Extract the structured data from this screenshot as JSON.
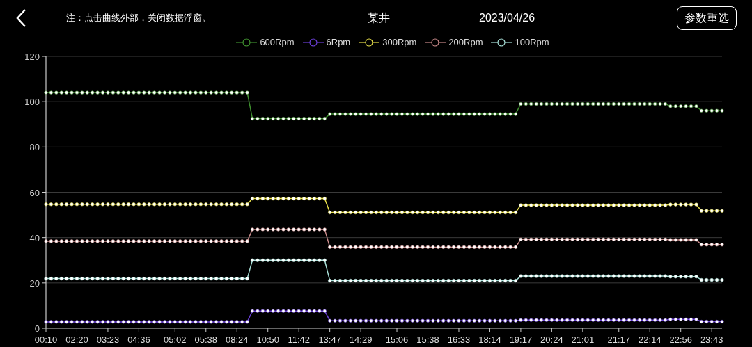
{
  "header": {
    "note": "注：点击曲线外部，关闭数据浮窗。",
    "title": "某井",
    "date": "2023/04/26",
    "button": "参数重选"
  },
  "chart": {
    "chart_data": {
      "type": "line",
      "categories": [
        "00:10",
        null,
        null,
        null,
        null,
        null,
        "02:20",
        null,
        null,
        null,
        null,
        null,
        "03:23",
        null,
        null,
        null,
        null,
        null,
        "04:36",
        null,
        null,
        null,
        null,
        null,
        null,
        "05:02",
        null,
        null,
        null,
        null,
        null,
        "05:38",
        null,
        null,
        null,
        null,
        null,
        "08:24",
        null,
        null,
        null,
        null,
        null,
        "10:50",
        null,
        null,
        null,
        null,
        null,
        "11:42",
        null,
        null,
        null,
        null,
        null,
        "13:47",
        null,
        null,
        null,
        null,
        null,
        "14:29",
        null,
        null,
        null,
        null,
        null,
        null,
        "15:06",
        null,
        null,
        null,
        null,
        null,
        "15:38",
        null,
        null,
        null,
        null,
        null,
        "16:33",
        null,
        null,
        null,
        null,
        null,
        "18:14",
        null,
        null,
        null,
        null,
        null,
        "19:17",
        null,
        null,
        null,
        null,
        null,
        "20:24",
        null,
        null,
        null,
        null,
        null,
        "21:01",
        null,
        null,
        null,
        null,
        null,
        null,
        "21:17",
        null,
        null,
        null,
        null,
        null,
        "22:14",
        null,
        null,
        null,
        null,
        null,
        "22:56",
        null,
        null,
        null,
        null,
        null,
        "23:43",
        null,
        null
      ],
      "ylim": [
        0,
        120
      ],
      "grid": true,
      "legend": "top",
      "yticks": [
        0,
        20,
        40,
        60,
        80,
        100,
        120
      ],
      "series": [
        {
          "name": "600Rpm",
          "color": "#3f8f2f",
          "marker": "circle",
          "values": [
            104,
            104,
            104,
            104,
            104,
            104,
            104,
            104,
            104,
            104,
            104,
            104,
            104,
            104,
            104,
            104,
            104,
            104,
            104,
            104,
            104,
            104,
            104,
            104,
            104,
            104,
            104,
            104,
            104,
            104,
            104,
            104,
            104,
            104,
            104,
            104,
            104,
            104,
            104,
            104,
            92.5,
            92.5,
            92.5,
            92.5,
            92.5,
            92.5,
            92.5,
            92.5,
            92.5,
            92.5,
            92.5,
            92.5,
            92.5,
            92.5,
            92.5,
            94.5,
            94.5,
            94.5,
            94.5,
            94.5,
            94.5,
            94.5,
            94.5,
            94.5,
            94.5,
            94.5,
            94.5,
            94.5,
            94.5,
            94.5,
            94.5,
            94.5,
            94.5,
            94.5,
            94.5,
            94.5,
            94.5,
            94.5,
            94.5,
            94.5,
            94.5,
            94.5,
            94.5,
            94.5,
            94.5,
            94.5,
            94.5,
            94.5,
            94.5,
            94.5,
            94.5,
            94.5,
            99,
            99,
            99,
            99,
            99,
            99,
            99,
            99,
            99,
            99,
            99,
            99,
            99,
            99,
            99,
            99,
            99,
            99,
            99,
            99,
            99,
            99,
            99,
            99,
            99,
            99,
            99,
            99,
            99,
            98,
            98,
            98,
            98,
            98,
            98,
            96,
            96,
            96,
            96,
            96
          ]
        },
        {
          "name": "6Rpm",
          "color": "#6a3fd6",
          "marker": "circle",
          "values": [
            2.8,
            2.8,
            2.8,
            2.8,
            2.8,
            2.8,
            2.8,
            2.8,
            2.8,
            2.8,
            2.8,
            2.8,
            2.8,
            2.8,
            2.8,
            2.8,
            2.8,
            2.8,
            2.8,
            2.8,
            2.8,
            2.8,
            2.8,
            2.8,
            2.8,
            2.8,
            2.8,
            2.8,
            2.8,
            2.8,
            2.8,
            2.8,
            2.8,
            2.8,
            2.8,
            2.8,
            2.8,
            2.8,
            2.8,
            2.8,
            7.6,
            7.6,
            7.6,
            7.6,
            7.6,
            7.6,
            7.6,
            7.6,
            7.6,
            7.6,
            7.6,
            7.6,
            7.6,
            7.6,
            7.6,
            3.3,
            3.3,
            3.3,
            3.3,
            3.3,
            3.3,
            3.3,
            3.3,
            3.3,
            3.3,
            3.3,
            3.3,
            3.3,
            3.3,
            3.3,
            3.3,
            3.3,
            3.3,
            3.3,
            3.3,
            3.3,
            3.3,
            3.3,
            3.3,
            3.3,
            3.3,
            3.3,
            3.3,
            3.3,
            3.3,
            3.3,
            3.3,
            3.3,
            3.3,
            3.3,
            3.3,
            3.3,
            3.6,
            3.6,
            3.6,
            3.6,
            3.6,
            3.6,
            3.6,
            3.6,
            3.6,
            3.6,
            3.6,
            3.6,
            3.6,
            3.6,
            3.6,
            3.6,
            3.6,
            3.6,
            3.6,
            3.6,
            3.6,
            3.6,
            3.6,
            3.6,
            3.6,
            3.6,
            3.6,
            3.6,
            3.6,
            3.9,
            3.9,
            3.9,
            3.9,
            3.9,
            3.9,
            2.9,
            2.9,
            2.9,
            2.9,
            2.9
          ]
        },
        {
          "name": "300Rpm",
          "color": "#e8e04a",
          "marker": "circle",
          "values": [
            54.7,
            54.7,
            54.7,
            54.7,
            54.7,
            54.7,
            54.7,
            54.7,
            54.7,
            54.7,
            54.7,
            54.7,
            54.7,
            54.7,
            54.7,
            54.7,
            54.7,
            54.7,
            54.7,
            54.7,
            54.7,
            54.7,
            54.7,
            54.7,
            54.7,
            54.7,
            54.7,
            54.7,
            54.7,
            54.7,
            54.7,
            54.7,
            54.7,
            54.7,
            54.7,
            54.7,
            54.7,
            54.7,
            54.7,
            54.7,
            57.2,
            57.2,
            57.2,
            57.2,
            57.2,
            57.2,
            57.2,
            57.2,
            57.2,
            57.2,
            57.2,
            57.2,
            57.2,
            57.2,
            57.2,
            51.1,
            51.1,
            51.1,
            51.1,
            51.1,
            51.1,
            51.1,
            51.1,
            51.1,
            51.1,
            51.1,
            51.1,
            51.1,
            51.1,
            51.1,
            51.1,
            51.1,
            51.1,
            51.1,
            51.1,
            51.1,
            51.1,
            51.1,
            51.1,
            51.1,
            51.1,
            51.1,
            51.1,
            51.1,
            51.1,
            51.1,
            51.1,
            51.1,
            51.1,
            51.1,
            51.1,
            51.1,
            54.3,
            54.3,
            54.3,
            54.3,
            54.3,
            54.3,
            54.3,
            54.3,
            54.3,
            54.3,
            54.3,
            54.3,
            54.3,
            54.3,
            54.3,
            54.3,
            54.3,
            54.3,
            54.3,
            54.3,
            54.3,
            54.3,
            54.3,
            54.3,
            54.3,
            54.3,
            54.3,
            54.3,
            54.3,
            54.6,
            54.6,
            54.6,
            54.6,
            54.6,
            54.6,
            51.8,
            51.8,
            51.8,
            51.8,
            51.8
          ]
        },
        {
          "name": "200Rpm",
          "color": "#c98a8a",
          "marker": "circle",
          "values": [
            38.4,
            38.4,
            38.4,
            38.4,
            38.4,
            38.4,
            38.4,
            38.4,
            38.4,
            38.4,
            38.4,
            38.4,
            38.4,
            38.4,
            38.4,
            38.4,
            38.4,
            38.4,
            38.4,
            38.4,
            38.4,
            38.4,
            38.4,
            38.4,
            38.4,
            38.4,
            38.4,
            38.4,
            38.4,
            38.4,
            38.4,
            38.4,
            38.4,
            38.4,
            38.4,
            38.4,
            38.4,
            38.4,
            38.4,
            38.4,
            43.6,
            43.6,
            43.6,
            43.6,
            43.6,
            43.6,
            43.6,
            43.6,
            43.6,
            43.6,
            43.6,
            43.6,
            43.6,
            43.6,
            43.6,
            35.8,
            35.8,
            35.8,
            35.8,
            35.8,
            35.8,
            35.8,
            35.8,
            35.8,
            35.8,
            35.8,
            35.8,
            35.8,
            35.8,
            35.8,
            35.8,
            35.8,
            35.8,
            35.8,
            35.8,
            35.8,
            35.8,
            35.8,
            35.8,
            35.8,
            35.8,
            35.8,
            35.8,
            35.8,
            35.8,
            35.8,
            35.8,
            35.8,
            35.8,
            35.8,
            35.8,
            35.8,
            39.2,
            39.2,
            39.2,
            39.2,
            39.2,
            39.2,
            39.2,
            39.2,
            39.2,
            39.2,
            39.2,
            39.2,
            39.2,
            39.2,
            39.2,
            39.2,
            39.2,
            39.2,
            39.2,
            39.2,
            39.2,
            39.2,
            39.2,
            39.2,
            39.2,
            39.2,
            39.2,
            39.2,
            39.2,
            39,
            39,
            39,
            39,
            39,
            39,
            36.9,
            36.9,
            36.9,
            36.9,
            36.9
          ]
        },
        {
          "name": "100Rpm",
          "color": "#a8e0d8",
          "marker": "circle",
          "values": [
            21.9,
            21.9,
            21.9,
            21.9,
            21.9,
            21.9,
            21.9,
            21.9,
            21.9,
            21.9,
            21.9,
            21.9,
            21.9,
            21.9,
            21.9,
            21.9,
            21.9,
            21.9,
            21.9,
            21.9,
            21.9,
            21.9,
            21.9,
            21.9,
            21.9,
            21.9,
            21.9,
            21.9,
            21.9,
            21.9,
            21.9,
            21.9,
            21.9,
            21.9,
            21.9,
            21.9,
            21.9,
            21.9,
            21.9,
            21.9,
            30,
            30,
            30,
            30,
            30,
            30,
            30,
            30,
            30,
            30,
            30,
            30,
            30,
            30,
            30,
            21,
            21,
            21,
            21,
            21,
            21,
            21,
            21,
            21,
            21,
            21,
            21,
            21,
            21,
            21,
            21,
            21,
            21,
            21,
            21,
            21,
            21,
            21,
            21,
            21,
            21,
            21,
            21,
            21,
            21,
            21,
            21,
            21,
            21,
            21,
            21,
            21,
            23,
            23,
            23,
            23,
            23,
            23,
            23,
            23,
            23,
            23,
            23,
            23,
            23,
            23,
            23,
            23,
            23,
            23,
            23,
            23,
            23,
            23,
            23,
            23,
            23,
            23,
            23,
            23,
            23,
            22.8,
            22.8,
            22.8,
            22.8,
            22.8,
            22.8,
            21.3,
            21.3,
            21.3,
            21.3,
            21.3
          ]
        }
      ]
    }
  }
}
